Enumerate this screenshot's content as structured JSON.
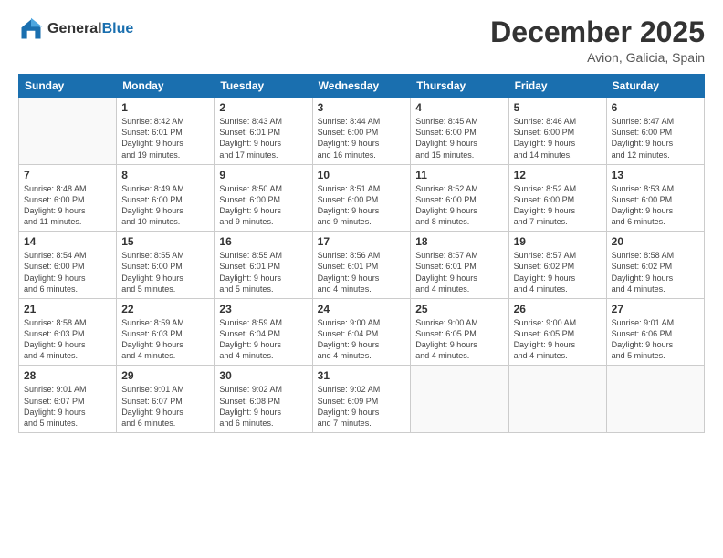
{
  "header": {
    "logo_line1": "General",
    "logo_line2": "Blue",
    "main_title": "December 2025",
    "subtitle": "Avion, Galicia, Spain"
  },
  "days_of_week": [
    "Sunday",
    "Monday",
    "Tuesday",
    "Wednesday",
    "Thursday",
    "Friday",
    "Saturday"
  ],
  "weeks": [
    [
      {
        "day": "",
        "info": ""
      },
      {
        "day": "1",
        "info": "Sunrise: 8:42 AM\nSunset: 6:01 PM\nDaylight: 9 hours\nand 19 minutes."
      },
      {
        "day": "2",
        "info": "Sunrise: 8:43 AM\nSunset: 6:01 PM\nDaylight: 9 hours\nand 17 minutes."
      },
      {
        "day": "3",
        "info": "Sunrise: 8:44 AM\nSunset: 6:00 PM\nDaylight: 9 hours\nand 16 minutes."
      },
      {
        "day": "4",
        "info": "Sunrise: 8:45 AM\nSunset: 6:00 PM\nDaylight: 9 hours\nand 15 minutes."
      },
      {
        "day": "5",
        "info": "Sunrise: 8:46 AM\nSunset: 6:00 PM\nDaylight: 9 hours\nand 14 minutes."
      },
      {
        "day": "6",
        "info": "Sunrise: 8:47 AM\nSunset: 6:00 PM\nDaylight: 9 hours\nand 12 minutes."
      }
    ],
    [
      {
        "day": "7",
        "info": "Sunrise: 8:48 AM\nSunset: 6:00 PM\nDaylight: 9 hours\nand 11 minutes."
      },
      {
        "day": "8",
        "info": "Sunrise: 8:49 AM\nSunset: 6:00 PM\nDaylight: 9 hours\nand 10 minutes."
      },
      {
        "day": "9",
        "info": "Sunrise: 8:50 AM\nSunset: 6:00 PM\nDaylight: 9 hours\nand 9 minutes."
      },
      {
        "day": "10",
        "info": "Sunrise: 8:51 AM\nSunset: 6:00 PM\nDaylight: 9 hours\nand 9 minutes."
      },
      {
        "day": "11",
        "info": "Sunrise: 8:52 AM\nSunset: 6:00 PM\nDaylight: 9 hours\nand 8 minutes."
      },
      {
        "day": "12",
        "info": "Sunrise: 8:52 AM\nSunset: 6:00 PM\nDaylight: 9 hours\nand 7 minutes."
      },
      {
        "day": "13",
        "info": "Sunrise: 8:53 AM\nSunset: 6:00 PM\nDaylight: 9 hours\nand 6 minutes."
      }
    ],
    [
      {
        "day": "14",
        "info": "Sunrise: 8:54 AM\nSunset: 6:00 PM\nDaylight: 9 hours\nand 6 minutes."
      },
      {
        "day": "15",
        "info": "Sunrise: 8:55 AM\nSunset: 6:00 PM\nDaylight: 9 hours\nand 5 minutes."
      },
      {
        "day": "16",
        "info": "Sunrise: 8:55 AM\nSunset: 6:01 PM\nDaylight: 9 hours\nand 5 minutes."
      },
      {
        "day": "17",
        "info": "Sunrise: 8:56 AM\nSunset: 6:01 PM\nDaylight: 9 hours\nand 4 minutes."
      },
      {
        "day": "18",
        "info": "Sunrise: 8:57 AM\nSunset: 6:01 PM\nDaylight: 9 hours\nand 4 minutes."
      },
      {
        "day": "19",
        "info": "Sunrise: 8:57 AM\nSunset: 6:02 PM\nDaylight: 9 hours\nand 4 minutes."
      },
      {
        "day": "20",
        "info": "Sunrise: 8:58 AM\nSunset: 6:02 PM\nDaylight: 9 hours\nand 4 minutes."
      }
    ],
    [
      {
        "day": "21",
        "info": "Sunrise: 8:58 AM\nSunset: 6:03 PM\nDaylight: 9 hours\nand 4 minutes."
      },
      {
        "day": "22",
        "info": "Sunrise: 8:59 AM\nSunset: 6:03 PM\nDaylight: 9 hours\nand 4 minutes."
      },
      {
        "day": "23",
        "info": "Sunrise: 8:59 AM\nSunset: 6:04 PM\nDaylight: 9 hours\nand 4 minutes."
      },
      {
        "day": "24",
        "info": "Sunrise: 9:00 AM\nSunset: 6:04 PM\nDaylight: 9 hours\nand 4 minutes."
      },
      {
        "day": "25",
        "info": "Sunrise: 9:00 AM\nSunset: 6:05 PM\nDaylight: 9 hours\nand 4 minutes."
      },
      {
        "day": "26",
        "info": "Sunrise: 9:00 AM\nSunset: 6:05 PM\nDaylight: 9 hours\nand 4 minutes."
      },
      {
        "day": "27",
        "info": "Sunrise: 9:01 AM\nSunset: 6:06 PM\nDaylight: 9 hours\nand 5 minutes."
      }
    ],
    [
      {
        "day": "28",
        "info": "Sunrise: 9:01 AM\nSunset: 6:07 PM\nDaylight: 9 hours\nand 5 minutes."
      },
      {
        "day": "29",
        "info": "Sunrise: 9:01 AM\nSunset: 6:07 PM\nDaylight: 9 hours\nand 6 minutes."
      },
      {
        "day": "30",
        "info": "Sunrise: 9:02 AM\nSunset: 6:08 PM\nDaylight: 9 hours\nand 6 minutes."
      },
      {
        "day": "31",
        "info": "Sunrise: 9:02 AM\nSunset: 6:09 PM\nDaylight: 9 hours\nand 7 minutes."
      },
      {
        "day": "",
        "info": ""
      },
      {
        "day": "",
        "info": ""
      },
      {
        "day": "",
        "info": ""
      }
    ]
  ]
}
